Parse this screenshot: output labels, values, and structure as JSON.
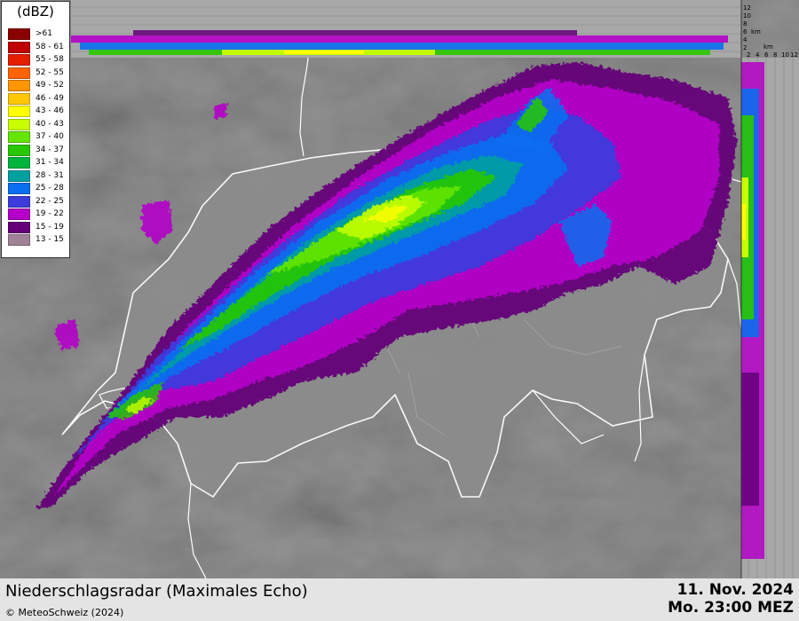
{
  "legend": {
    "title": "(dBZ)",
    "items": [
      {
        "label": ">61",
        "color": "#8b0000"
      },
      {
        "label": "58 - 61",
        "color": "#c00000"
      },
      {
        "label": "55 - 58",
        "color": "#e61e00"
      },
      {
        "label": "52 - 55",
        "color": "#ff6400"
      },
      {
        "label": "49 - 52",
        "color": "#ff9600"
      },
      {
        "label": "46 - 49",
        "color": "#ffc800"
      },
      {
        "label": "43 - 46",
        "color": "#ffff00"
      },
      {
        "label": "40 - 43",
        "color": "#c8ff00"
      },
      {
        "label": "37 - 40",
        "color": "#64e600"
      },
      {
        "label": "34 - 37",
        "color": "#28c800"
      },
      {
        "label": "31 - 34",
        "color": "#00b43c"
      },
      {
        "label": "28 - 31",
        "color": "#00a0a0"
      },
      {
        "label": "25 - 28",
        "color": "#0a6ef0"
      },
      {
        "label": "22 - 25",
        "color": "#3c3cdc"
      },
      {
        "label": "19 - 22",
        "color": "#b400c8"
      },
      {
        "label": "15 - 19",
        "color": "#640078"
      },
      {
        "label": "13 - 15",
        "color": "#a08296"
      }
    ]
  },
  "profile_panel": {
    "top_altitude_ticks": [
      "12",
      "10",
      "8",
      "6",
      "4",
      "2"
    ],
    "unit": "km",
    "side_distance_ticks": [
      "2",
      "4",
      "6",
      "8",
      "10",
      "12"
    ]
  },
  "footer": {
    "product_title": "Niederschlagsradar (Maximales Echo)",
    "copyright": "© MeteoSchweiz (2024)",
    "date": "11. Nov. 2024",
    "time": "Mo. 23:00 MEZ"
  },
  "colors": {
    "terrain_base": "#6a6a6a",
    "switzerland_fill": "#8c8c8c",
    "border_line": "#ffffff",
    "profile_background": "#a8a8a8"
  }
}
